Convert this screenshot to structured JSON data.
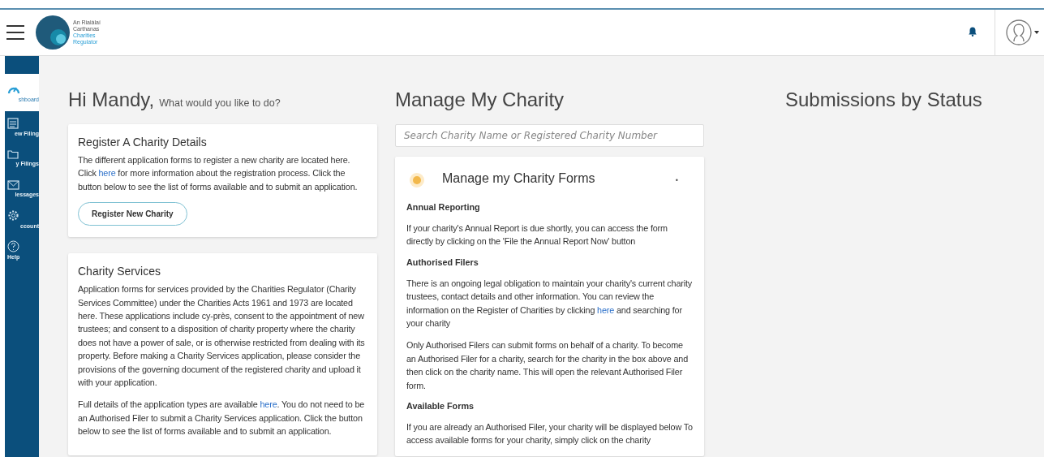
{
  "header": {
    "logo_lines": [
      "An Rialálaí",
      "Carthanas",
      "Charities",
      "Regulator"
    ]
  },
  "sidebar": {
    "items": [
      {
        "label": "shboard",
        "selected": true
      },
      {
        "label": "ew Filing",
        "selected": false
      },
      {
        "label": "y Filings",
        "selected": false
      },
      {
        "label": "lessages",
        "selected": false
      },
      {
        "label": "ccount",
        "selected": false
      },
      {
        "label": "Help",
        "selected": false
      }
    ]
  },
  "greeting": {
    "title": "Hi Mandy,",
    "subtitle": "What would you like to do?"
  },
  "register_card": {
    "title": "Register A Charity Details",
    "paragraphs": [
      [
        {
          "text": "The different application forms to register a new charity are located here. Click "
        },
        {
          "link": "here"
        },
        {
          "text": " for more information about the registration process. Click the button below to see the list of forms available and to submit an application."
        }
      ]
    ],
    "button": "Register New Charity"
  },
  "services_card": {
    "title": "Charity Services",
    "paragraphs": [
      [
        {
          "text": "Application forms for services provided by the Charities Regulator (Charity Services Committee) under the Charities Acts 1961 and 1973 are located here. These applications include cy-près, consent to the appointment of new trustees; and consent to a disposition of charity property where the charity does not have a power of sale, or is otherwise restricted from dealing with its property. Before making a Charity Services application, please consider the provisions of the governing document of the registered charity and upload it with your application."
        }
      ],
      [
        {
          "text": "Full details of the application types are available "
        },
        {
          "link": "here"
        },
        {
          "text": ". You do not need to be an Authorised Filer to submit a Charity Services application. Click the button below to see the list of forms available and to submit an application."
        }
      ]
    ]
  },
  "manage": {
    "title": "Manage My Charity",
    "search": {
      "placeholder": "Search Charity Name or Registered Charity Number"
    },
    "forms_card": {
      "title": "Manage my Charity Forms",
      "marker": "•",
      "sections": [
        {
          "heading": "Annual Reporting",
          "paragraphs": [
            [
              {
                "text": "If your charity's Annual Report is due shortly, you can access the form directly by clicking on the 'File the Annual Report Now' button"
              }
            ]
          ]
        },
        {
          "heading": "Authorised Filers",
          "paragraphs": [
            [
              {
                "text": "There is an ongoing legal obligation to maintain your charity's current charity trustees, contact details and other information. You can review the information on the Register of Charities by clicking "
              },
              {
                "link": "here"
              },
              {
                "text": " and searching for your charity"
              }
            ],
            [
              {
                "text": "Only Authorised Filers can submit forms on behalf of a charity. To become an Authorised Filer for a charity, search for the charity in the box above and then click on the charity name. This will open the relevant Authorised Filer form."
              }
            ]
          ]
        },
        {
          "heading": "Available Forms",
          "paragraphs": [
            [
              {
                "text": "If you are already an Authorised Filer, your charity will be displayed below To access available forms for your charity, simply click on the charity"
              }
            ]
          ]
        }
      ]
    }
  },
  "submissions": {
    "title": "Submissions by Status"
  }
}
